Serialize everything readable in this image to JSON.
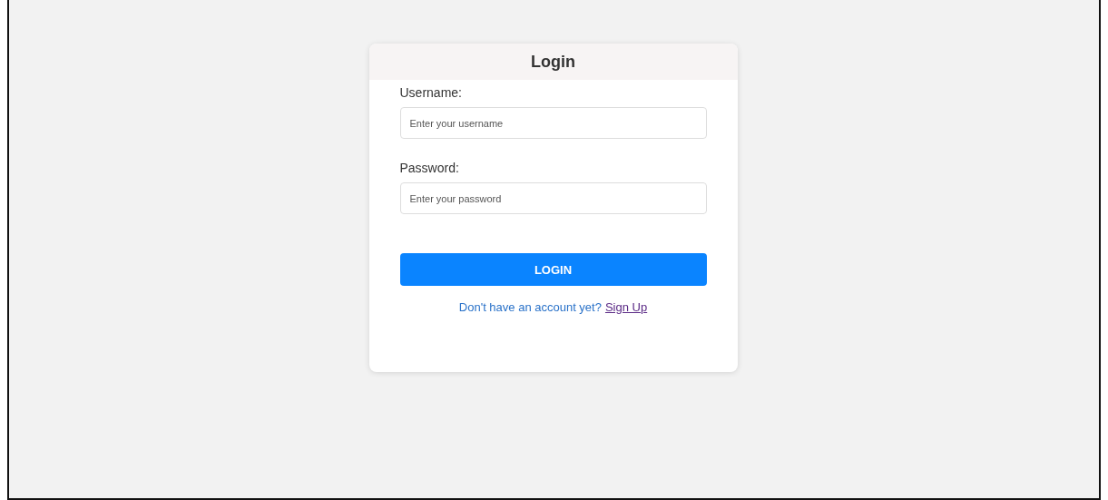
{
  "login_card": {
    "title": "Login",
    "fields": [
      {
        "label": "Username:",
        "placeholder": "Enter your username"
      },
      {
        "label": "Password:",
        "placeholder": "Enter your password"
      }
    ],
    "button": "LOGIN",
    "signup_prompt": {
      "text": "Don't have an account yet?",
      "link": "Sign Up"
    }
  }
}
